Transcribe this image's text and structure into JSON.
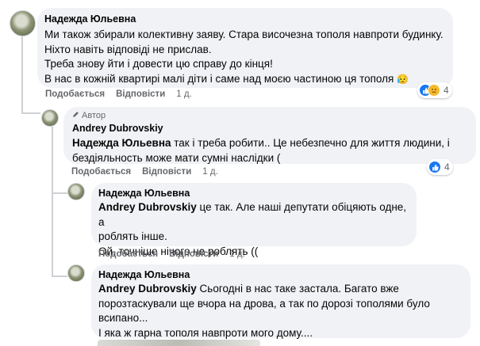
{
  "comments": [
    {
      "author": "Надежда Юльевна",
      "lines": [
        "Ми також збирали колективну заяву. Стара височезна тополя навпроти будинку.",
        "Ніхто навіть відповіді не прислав.",
        "Треба знову йти і довести цю справу до кінця!",
        "В нас в кожній квартирі малі діти і саме над моєю частиною ця тополя"
      ],
      "emoji": "😥",
      "like_label": "Подобається",
      "reply_label": "Відповісти",
      "time": "1 д.",
      "reactions_count": "4"
    },
    {
      "author_tag": "Автор",
      "author": "Andrey Dubrovskiy",
      "mention": "Надежда Юльевна",
      "line1_rest": " так і треба робити.. Це небезпечно для життя людини, і",
      "line2": "бездіяльность може мати сумні наслідки (",
      "like_label": "Подобається",
      "reply_label": "Відповісти",
      "time": "1 д.",
      "reactions_count": "4"
    },
    {
      "author": "Надежда Юльевна",
      "mention": "Andrey Dubrovskiy",
      "line1_rest": " це так. Але наші депутати обіцяють одне, а",
      "line2": "роблять інше.",
      "line3": "Ой, точніше нічого не роблять ((",
      "like_label": "Подобається",
      "reply_label": "Відповісти",
      "time": "1 д."
    },
    {
      "author": "Надежда Юльевна",
      "mention": "Andrey Dubrovskiy",
      "line1_rest": " Сьогодні в нас таке застала. Багато вже",
      "line2": "порозтаскували ще вчора на дрова, а так по дорозі тополями було",
      "line3": "всипано...",
      "line4": "І яка ж гарна тополя навпроти мого дому...."
    }
  ]
}
